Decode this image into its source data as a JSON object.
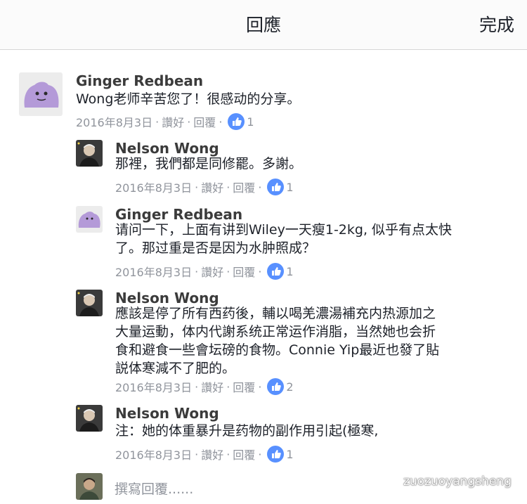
{
  "header": {
    "title": "回應",
    "done": "完成"
  },
  "comments": [
    {
      "name": "Ginger Redbean",
      "text": "Wong老师辛苦您了！很感动的分享。",
      "date": "2016年8月3日",
      "like": "讚好",
      "reply": "回覆",
      "likes": "1"
    },
    {
      "name": "Nelson Wong",
      "text": "那裡，我們都是同修罷。多謝。",
      "date": "2016年8月3日",
      "like": "讚好",
      "reply": "回覆",
      "likes": "1"
    },
    {
      "name": "Ginger Redbean",
      "text": "请问一下，上面有讲到Wiley一天瘦1-2kg, 似乎有点太快\n了。那过重是否是因为水肿照成？",
      "date": "2016年8月3日",
      "like": "讚好",
      "reply": "回覆",
      "likes": "1"
    },
    {
      "name": "Nelson Wong",
      "text": "應該是停了所有西药後，輔以喝羌濃湯補充内热源加之\n大量运動，体内代謝系统正常运作消脂，当然她也会折\n食和避食一些會坛磅的食物。Connie Yip最近也發了貼\n説体寒減不了肥的。",
      "date": "2016年8月3日",
      "like": "讚好",
      "reply": "回覆",
      "likes": "2"
    },
    {
      "name": "Nelson Wong",
      "text": "注：她的体重暴升是药物的副作用引起(極寒,",
      "date": "2016年8月3日",
      "like": "讚好",
      "reply": "回覆",
      "likes": "1"
    }
  ],
  "reply_box": {
    "placeholder": "撰寫回覆......"
  },
  "watermark": "zuozuoyangsheng",
  "colors": {
    "like_blue": "#5890ff",
    "meta_gray": "#90949c",
    "text": "#1d2129"
  },
  "icons": {
    "like": "thumbs-up-icon",
    "watermark": "wechat-icon"
  }
}
